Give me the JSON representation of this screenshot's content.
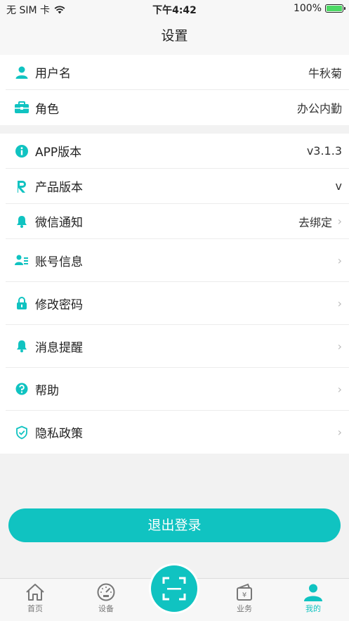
{
  "status_bar": {
    "carrier": "无 SIM 卡",
    "time": "下午4:42",
    "battery_text": "100%",
    "battery_level": 1.0
  },
  "nav": {
    "title": "设置"
  },
  "profile": [
    {
      "label": "用户名",
      "value": "牛秋菊"
    },
    {
      "label": "角色",
      "value": "办公内勤"
    }
  ],
  "settings": [
    {
      "label": "APP版本",
      "value": "v3.1.3"
    },
    {
      "label": "产品版本",
      "value": "v"
    },
    {
      "label": "微信通知",
      "value": "去绑定"
    },
    {
      "label": "账号信息"
    },
    {
      "label": "修改密码"
    },
    {
      "label": "消息提醒"
    },
    {
      "label": "帮助"
    },
    {
      "label": "隐私政策"
    }
  ],
  "logout_label": "退出登录",
  "tabs": [
    {
      "label": "首页",
      "icon": "home-icon"
    },
    {
      "label": "设备",
      "icon": "gauge-icon"
    },
    {
      "label": "",
      "icon": "scan-icon"
    },
    {
      "label": "业务",
      "icon": "wallet-icon"
    },
    {
      "label": "我的",
      "icon": "user-icon"
    }
  ],
  "colors": {
    "accent": "#10c3c1",
    "battery": "#4cd964"
  },
  "chevron": "›"
}
